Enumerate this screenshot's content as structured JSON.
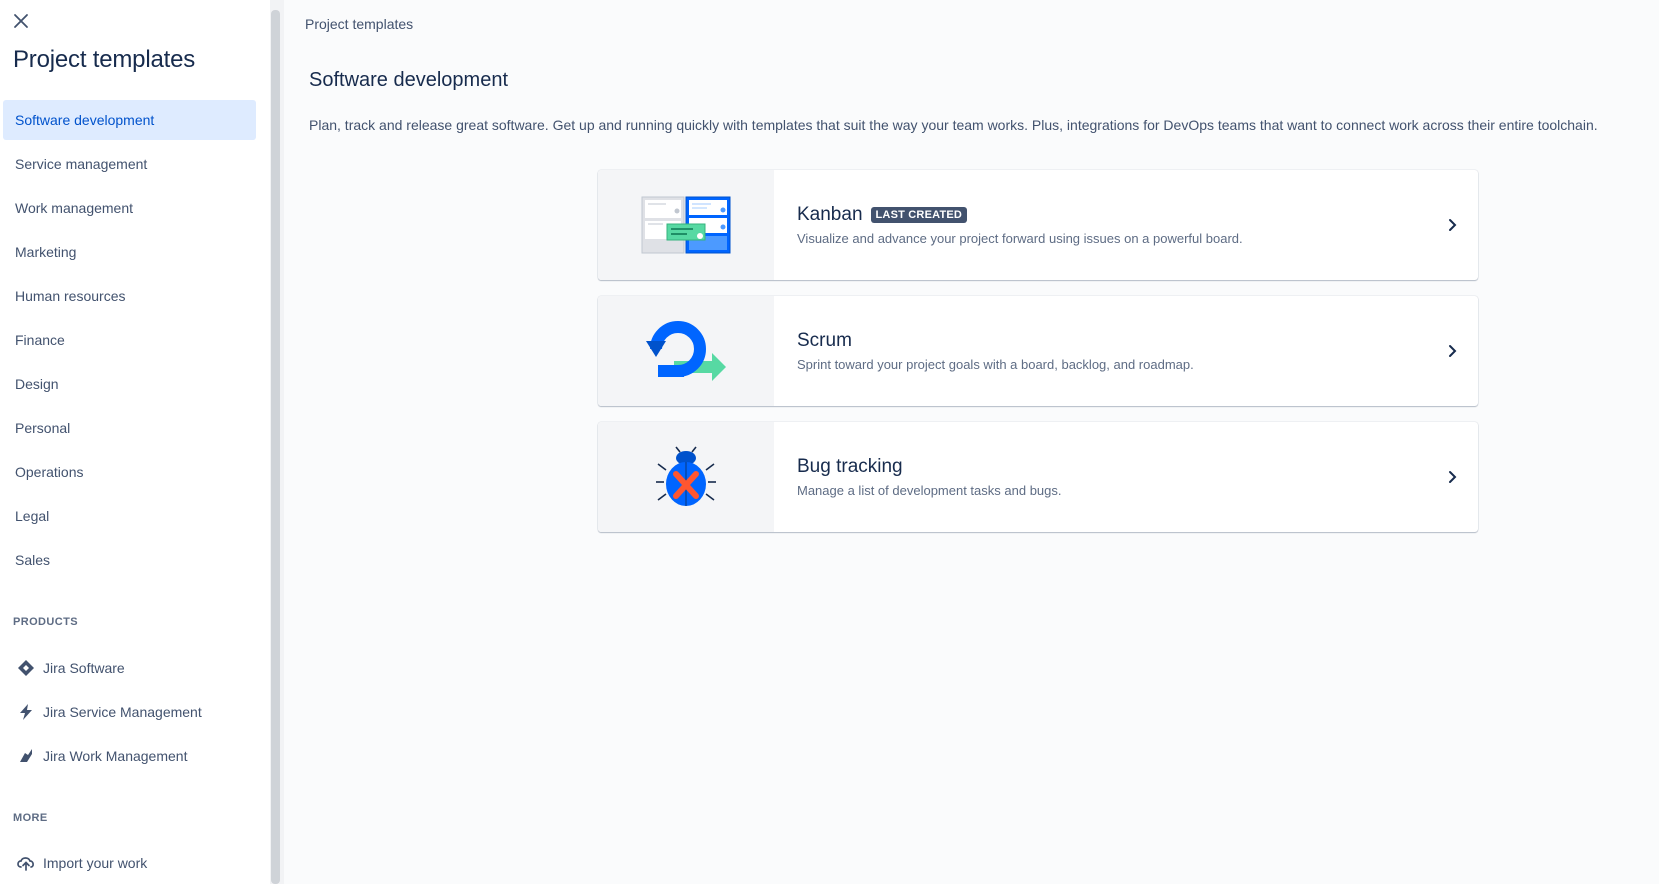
{
  "sidebar": {
    "title": "Project templates",
    "categories": [
      {
        "label": "Software development",
        "active": true
      },
      {
        "label": "Service management"
      },
      {
        "label": "Work management"
      },
      {
        "label": "Marketing"
      },
      {
        "label": "Human resources"
      },
      {
        "label": "Finance"
      },
      {
        "label": "Design"
      },
      {
        "label": "Personal"
      },
      {
        "label": "Operations"
      },
      {
        "label": "Legal"
      },
      {
        "label": "Sales"
      }
    ],
    "products_heading": "PRODUCTS",
    "products": [
      {
        "label": "Jira Software",
        "icon": "jira-software-icon"
      },
      {
        "label": "Jira Service Management",
        "icon": "jira-service-management-icon"
      },
      {
        "label": "Jira Work Management",
        "icon": "jira-work-management-icon"
      }
    ],
    "more_heading": "MORE",
    "more": [
      {
        "label": "Import your work",
        "icon": "cloud-upload-icon"
      }
    ]
  },
  "main": {
    "breadcrumb": "Project templates",
    "title": "Software development",
    "description": "Plan, track and release great software. Get up and running quickly with templates that suit the way your team works. Plus, integrations for DevOps teams that want to connect work across their entire toolchain.",
    "templates": [
      {
        "name": "Kanban",
        "badge": "LAST CREATED",
        "description": "Visualize and advance your project forward using issues on a powerful board.",
        "icon": "kanban-board-illustration"
      },
      {
        "name": "Scrum",
        "badge": "",
        "description": "Sprint toward your project goals with a board, backlog, and roadmap.",
        "icon": "scrum-cycle-illustration"
      },
      {
        "name": "Bug tracking",
        "badge": "",
        "description": "Manage a list of development tasks and bugs.",
        "icon": "bug-illustration"
      }
    ]
  },
  "colors": {
    "accent": "#0052cc",
    "active_bg": "#deebff",
    "text": "#172b4d",
    "muted": "#42526e"
  }
}
